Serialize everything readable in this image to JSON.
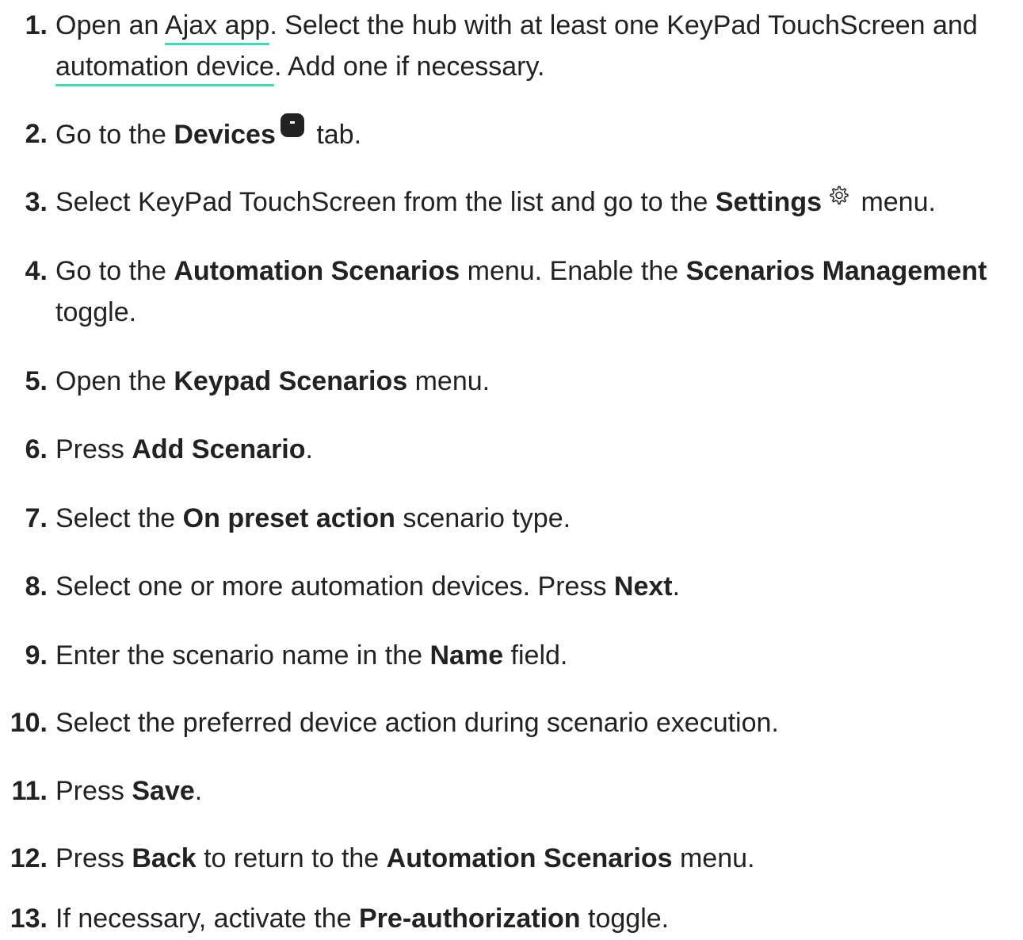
{
  "steps": [
    {
      "number": "1.",
      "parts": [
        "Open an ",
        "Ajax app",
        ". Select the hub with at least one KeyPad TouchScreen and ",
        "automation device",
        ". Add one if necessary."
      ]
    },
    {
      "number": "2.",
      "parts": [
        "Go to the ",
        "Devices",
        " tab."
      ],
      "icon": "devices-tab-icon"
    },
    {
      "number": "3.",
      "parts": [
        "Select KeyPad TouchScreen from the list and go to the ",
        "Settings",
        " menu."
      ],
      "icon": "gear-icon"
    },
    {
      "number": "4.",
      "parts": [
        "Go to the ",
        "Automation Scenarios",
        " menu. Enable the ",
        "Scenarios Management",
        " toggle."
      ]
    },
    {
      "number": "5.",
      "parts": [
        "Open the ",
        "Keypad Scenarios",
        " menu."
      ]
    },
    {
      "number": "6.",
      "parts": [
        "Press ",
        "Add Scenario",
        "."
      ]
    },
    {
      "number": "7.",
      "parts": [
        "Select the ",
        "On preset action",
        " scenario type."
      ]
    },
    {
      "number": "8.",
      "parts": [
        "Select one or more automation devices. Press ",
        "Next",
        "."
      ]
    },
    {
      "number": "9.",
      "parts": [
        "Enter the scenario name in the ",
        "Name",
        " field."
      ]
    },
    {
      "number": "10.",
      "parts": [
        "Select the preferred device action during scenario execution."
      ]
    },
    {
      "number": "11.",
      "parts": [
        "Press ",
        "Save",
        "."
      ]
    },
    {
      "number": "12.",
      "parts": [
        "Press ",
        "Back",
        " to return to the ",
        "Automation Scenarios",
        " menu."
      ]
    },
    {
      "number": "13.",
      "parts": [
        "If necessary, activate the ",
        "Pre-authorization",
        " toggle."
      ]
    }
  ],
  "colors": {
    "text": "#222222",
    "link_underline": "#3ddbb3",
    "background": "#ffffff"
  }
}
